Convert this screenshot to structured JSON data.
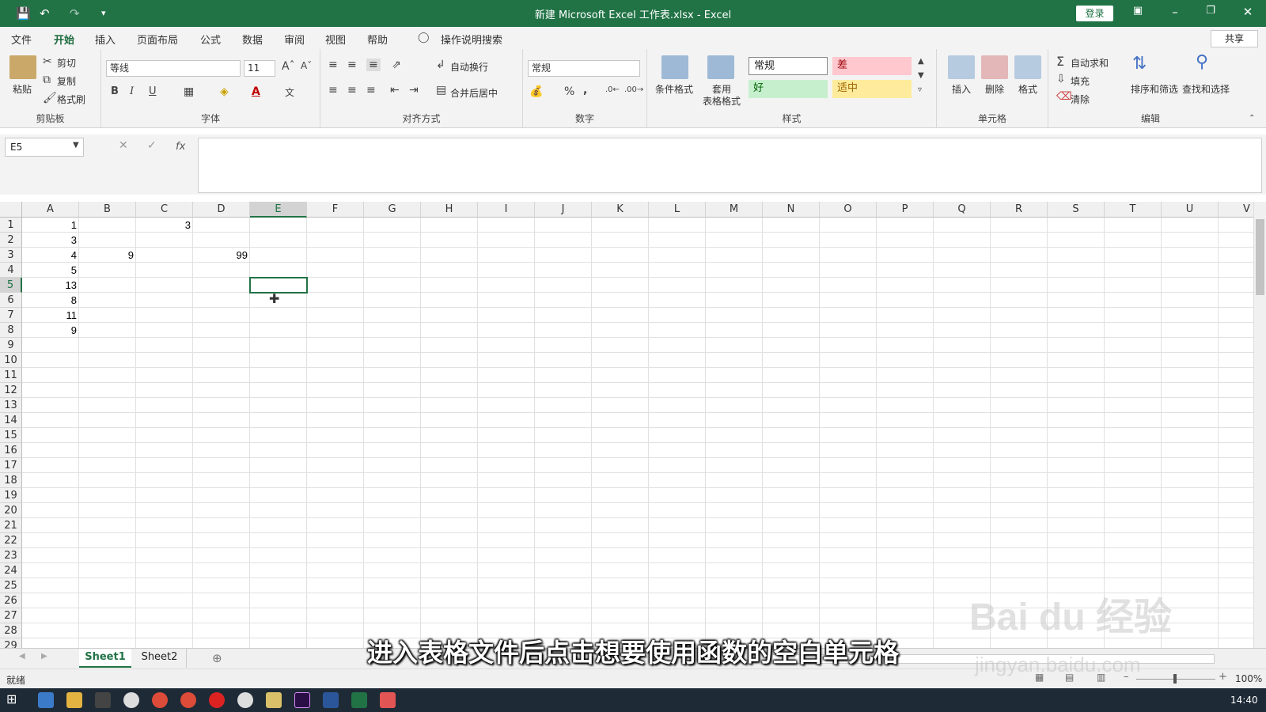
{
  "window": {
    "title": "新建 Microsoft Excel 工作表.xlsx  -  Excel",
    "login_label": "登录"
  },
  "menu": {
    "items": [
      "文件",
      "开始",
      "插入",
      "页面布局",
      "公式",
      "数据",
      "审阅",
      "视图",
      "帮助"
    ],
    "search_placeholder": "操作说明搜索",
    "share_label": "共享"
  },
  "ribbon": {
    "clipboard": {
      "paste": "粘贴",
      "cut": "剪切",
      "copy": "复制",
      "format_painter": "格式刷",
      "label": "剪贴板"
    },
    "font": {
      "name": "等线",
      "size": "11",
      "bold": "B",
      "italic": "I",
      "underline": "U",
      "label": "字体"
    },
    "alignment": {
      "wrap": "自动换行",
      "merge": "合并后居中",
      "label": "对齐方式"
    },
    "number": {
      "format": "常规",
      "percent": "%",
      "comma": ",",
      "label": "数字"
    },
    "styles": {
      "conditional": "条件格式",
      "table_format_1": "套用",
      "table_format_2": "表格格式",
      "normal": "常规",
      "bad": "差",
      "good": "好",
      "neutral": "适中",
      "label": "样式"
    },
    "cells": {
      "insert": "插入",
      "delete": "删除",
      "format": "格式",
      "label": "单元格"
    },
    "editing": {
      "autosum": "自动求和",
      "fill": "填充",
      "clear": "清除",
      "sort": "排序和筛选",
      "find": "查找和选择",
      "label": "编辑"
    }
  },
  "formula_bar": {
    "name_box": "E5",
    "fx": "fx",
    "content": ""
  },
  "columns": [
    "A",
    "B",
    "C",
    "D",
    "E",
    "F",
    "G",
    "H",
    "I",
    "J",
    "K",
    "L",
    "M",
    "N",
    "O",
    "P",
    "Q",
    "R",
    "S",
    "T",
    "U",
    "V"
  ],
  "rows": [
    "1",
    "2",
    "3",
    "4",
    "5",
    "6",
    "7",
    "8",
    "9",
    "10",
    "11",
    "12",
    "13",
    "14",
    "15",
    "16",
    "17",
    "18",
    "19",
    "20",
    "21",
    "22",
    "23",
    "24",
    "25",
    "26",
    "27",
    "28",
    "29"
  ],
  "cells": [
    {
      "ref": "A1",
      "value": "1"
    },
    {
      "ref": "C1",
      "value": "3"
    },
    {
      "ref": "A2",
      "value": "3"
    },
    {
      "ref": "A3",
      "value": "4"
    },
    {
      "ref": "B3",
      "value": "9"
    },
    {
      "ref": "D3",
      "value": "99"
    },
    {
      "ref": "A4",
      "value": "5"
    },
    {
      "ref": "A5",
      "value": "13"
    },
    {
      "ref": "A6",
      "value": "8"
    },
    {
      "ref": "A7",
      "value": "11"
    },
    {
      "ref": "A8",
      "value": "9"
    }
  ],
  "selected_cell": "E5",
  "sheets": {
    "tabs": [
      "Sheet1",
      "Sheet2"
    ],
    "active": "Sheet1"
  },
  "status": {
    "ready": "就绪",
    "zoom": "100%",
    "clock": "14:40"
  },
  "caption": "进入表格文件后点击想要使用函数的空白单元格",
  "watermark": {
    "logo": "Bai du 经验",
    "url": "jingyan.baidu.com"
  },
  "colors": {
    "excel_green": "#217346",
    "bad_bg": "#ffc7ce",
    "good_bg": "#c6efce",
    "neutral_bg": "#ffeb9c"
  }
}
